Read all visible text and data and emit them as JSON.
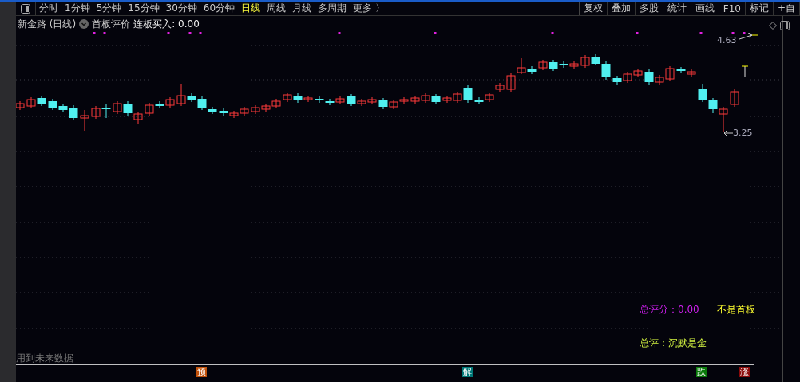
{
  "toolbar": {
    "tabs": [
      {
        "label": "分时",
        "selected": false
      },
      {
        "label": "1分钟",
        "selected": false
      },
      {
        "label": "5分钟",
        "selected": false
      },
      {
        "label": "15分钟",
        "selected": false
      },
      {
        "label": "30分钟",
        "selected": false
      },
      {
        "label": "60分钟",
        "selected": false
      },
      {
        "label": "日线",
        "selected": true
      },
      {
        "label": "周线",
        "selected": false
      },
      {
        "label": "月线",
        "selected": false
      },
      {
        "label": "多周期",
        "selected": false
      },
      {
        "label": "更多 〉",
        "selected": false
      }
    ],
    "buttons": [
      "复权",
      "叠加",
      "多股",
      "统计",
      "画线",
      "F10",
      "标记",
      "+自"
    ]
  },
  "chart_header": {
    "title": "新金路 (日线)",
    "indicator": "首板评价",
    "reading": "连板买入: 0.00"
  },
  "price_labels": [
    {
      "text": "4.63"
    },
    {
      "text": "3.25"
    }
  ],
  "summary": {
    "score": "总评分：0.00",
    "board": "不是首板",
    "comment": "总评：沉默是金"
  },
  "footnote": "用到未来数据",
  "markers": [
    {
      "text": "预",
      "color": "#c0500a"
    },
    {
      "text": "解",
      "color": "#007878"
    },
    {
      "text": "跌",
      "color": "#0a7a0a"
    },
    {
      "text": "涨",
      "color": "#8a0a0a"
    }
  ]
}
